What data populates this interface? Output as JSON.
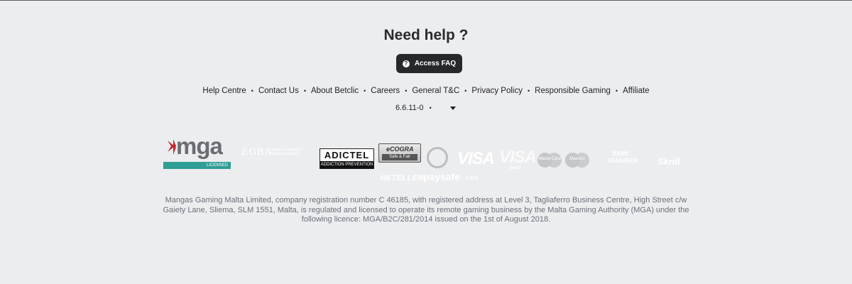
{
  "help": {
    "title": "Need help ?",
    "faq_button_label": "Access FAQ",
    "faq_icon_glyph": "?"
  },
  "footer_links": [
    {
      "label": "Help Centre"
    },
    {
      "label": "Contact Us"
    },
    {
      "label": "About Betclic"
    },
    {
      "label": "Careers"
    },
    {
      "label": "General T&C"
    },
    {
      "label": "Privacy Policy"
    },
    {
      "label": "Responsible Gaming"
    },
    {
      "label": "Affiliate"
    }
  ],
  "separator": "•",
  "version": "6.6.11-0",
  "logos": {
    "mga": {
      "text": "mga",
      "sub": "LICENSED"
    },
    "egba": {
      "text": "EGBA",
      "sub": "European Gaming & Betting Association"
    },
    "adictel": {
      "text": "ADICTEL",
      "sub": "ADDICTION PREVENTION"
    },
    "ecogra": {
      "text": "eCOGRA",
      "sub": "Safe & Fair"
    },
    "visa_electron": {
      "text": "VISA"
    },
    "visa": {
      "text": "VISA",
      "sub": "Electron"
    },
    "mastercard": {
      "text": "MasterCard"
    },
    "maestro": {
      "text": "Maestro"
    },
    "bank": {
      "text": "BANK TRANSFER"
    },
    "skrill": {
      "text": "Skrill"
    },
    "neteller": {
      "text": "NETELLER"
    },
    "paysafe": {
      "text": "paysafe",
      "sub": "card"
    }
  },
  "legal_text": "Mangas Gaming Malta Limited, company registration number C 46185, with registered address at Level 3, Tagliaferro Business Centre, High Street c/w Gaiety Lane, Sliema, SLM 1551, Malta, is regulated and licensed to operate its remote gaming business by the Malta Gaming Authority (MGA) under the following licence: MGA/B2C/281/2014 issued on the 1st of August 2018.",
  "colors": {
    "background": "#ecedef",
    "button_dark": "#26282b",
    "mga_teal": "#2f9e95",
    "mga_red": "#c3262e",
    "legal_text": "#6e6f7a"
  }
}
